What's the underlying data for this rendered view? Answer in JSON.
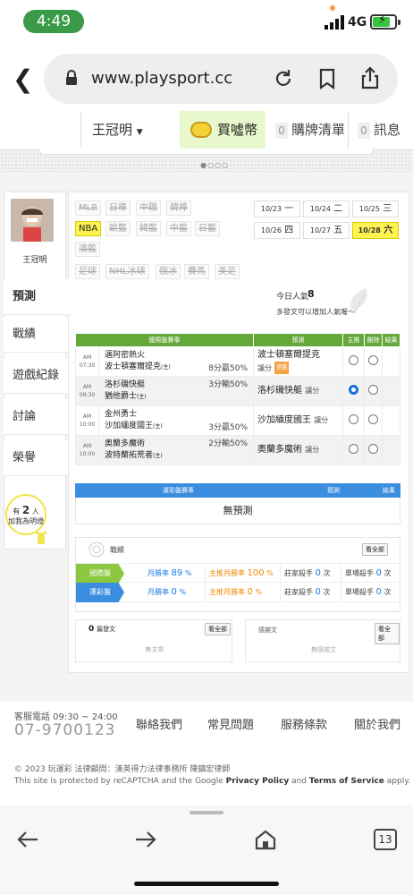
{
  "status": {
    "time": "4:49",
    "network": "4G"
  },
  "browser": {
    "url": "www.playsport.cc",
    "tab_count": "13"
  },
  "site_nav": {
    "user": "王冠明",
    "buy_label": "買噓幣",
    "cart_label": "購牌清單",
    "cart_count": "0",
    "msg_label": "訊息",
    "msg_count": "0"
  },
  "profile": {
    "name": "王冠明"
  },
  "side_nav": [
    "預測",
    "戰績",
    "遊戲紀錄",
    "討論",
    "榮譽"
  ],
  "bulb": {
    "prefix": "有",
    "count": "2",
    "suffix": "人",
    "line2": "加我為明燈"
  },
  "leagues": [
    [
      "MLB",
      "日棒",
      "中職",
      "韓棒"
    ],
    [
      "NBA",
      "歐籃",
      "韓籃",
      "中籃",
      "日籃"
    ],
    [
      "澳籃"
    ],
    [
      "足球",
      "NHL冰球",
      "俄冰",
      "賽馬",
      "美足"
    ]
  ],
  "active_league": "NBA",
  "dates": [
    {
      "d": "10/23",
      "w": "一"
    },
    {
      "d": "10/24",
      "w": "二"
    },
    {
      "d": "10/25",
      "w": "三"
    },
    {
      "d": "10/26",
      "w": "四"
    },
    {
      "d": "10/27",
      "w": "五"
    },
    {
      "d": "10/28",
      "w": "六"
    }
  ],
  "active_date": "10/28",
  "popularity": {
    "label": "今日人氣",
    "value": "8",
    "sub": "多發文可以增加人氣喔～"
  },
  "intl_table": {
    "headers": [
      "國際盤賽事",
      "預測",
      "主推",
      "刪除",
      "結果"
    ],
    "rows": [
      {
        "ampm": "AM",
        "time": "07:30",
        "away": "邁阿密熱火",
        "home": "波士頓塞爾提克",
        "home_tag": "主",
        "handicap": "8分贏50%",
        "pick": "波士頓塞爾提克",
        "pick_type": "讓分",
        "badge": "過盤",
        "main": false
      },
      {
        "ampm": "AM",
        "time": "09:30",
        "away": "洛杉磯快艇",
        "home": "猶他爵士",
        "home_tag": "主",
        "handicap": "3分輸50%",
        "pick": "洛杉磯快艇",
        "pick_type": "讓分",
        "badge": "",
        "main": true
      },
      {
        "ampm": "AM",
        "time": "10:00",
        "away": "金州勇士",
        "home": "沙加緬度國王",
        "home_tag": "主",
        "handicap": "3分贏50%",
        "pick": "沙加緬度國王",
        "pick_type": "讓分",
        "badge": "",
        "main": false
      },
      {
        "ampm": "AM",
        "time": "10:00",
        "away": "奧蘭多魔術",
        "home": "波特蘭拓荒者",
        "home_tag": "主",
        "handicap": "2分輸50%",
        "pick": "奧蘭多魔術",
        "pick_type": "讓分",
        "badge": "",
        "main": false
      }
    ]
  },
  "lottery_table": {
    "headers": [
      "運彩盤賽事",
      "預測",
      "結果"
    ],
    "empty": "無預測"
  },
  "record": {
    "title": "戰績",
    "see_all": "看全部",
    "rows": [
      {
        "tag": "國際盤",
        "month_label": "月勝率",
        "month_val": "89",
        "main_label": "主推月勝率",
        "main_val": "100",
        "banker_label": "莊家殺手",
        "banker_val": "0",
        "single_label": "單場殺手",
        "single_val": "0"
      },
      {
        "tag": "運彩盤",
        "month_label": "月勝率",
        "month_val": "0",
        "main_label": "主推月勝率",
        "main_val": "0",
        "banker_label": "莊家殺手",
        "banker_val": "0",
        "single_label": "單場殺手",
        "single_val": "0"
      }
    ],
    "pct": "%",
    "count_unit": "次"
  },
  "posts": {
    "count": "0",
    "label": "篇發文",
    "see_all": "看全部",
    "empty": "無文章"
  },
  "replies": {
    "label": "感謝文",
    "see_all": "看全部",
    "empty": "無感謝文"
  },
  "footer": {
    "phone_label": "客服電話 09:30 ~ 24:00",
    "phone": "07-9700123",
    "links": [
      "聯絡我們",
      "常見問題",
      "服務條款",
      "關於我們"
    ],
    "copyright": "© 2023 玩運彩 法律顧問：漢英得力法律事務所 陳鎮宏律師",
    "captcha_pre": "This site is protected by reCAPTCHA and the Google ",
    "privacy": "Privacy Policy",
    "and": " and ",
    "terms": "Terms of Service",
    "captcha_post": " apply."
  },
  "colors": {
    "green": "#65a83a",
    "blue": "#3b8de0",
    "yellow": "#fff34f",
    "orange": "#f2a23a"
  }
}
